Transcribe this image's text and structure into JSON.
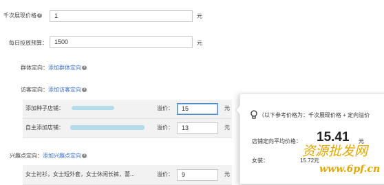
{
  "form": {
    "cpm": {
      "label": "千次展现价格",
      "value": "1",
      "unit": "元"
    },
    "daily_budget": {
      "label": "每日投放预算：",
      "value": "1500",
      "unit": "元"
    },
    "group_targeting": {
      "label": "群体定向：",
      "link": "添加群体定向"
    },
    "visitor_targeting": {
      "label": "访客定向：",
      "link": "添加访客定向"
    },
    "seed_shops": {
      "label": "添加种子店铺：",
      "premium_label": "溢价：",
      "value": "15",
      "unit": "元"
    },
    "own_shop": {
      "label": "自主添加店铺：",
      "premium_label": "溢价：",
      "value": "13",
      "unit": "元"
    },
    "interest_targeting": {
      "label": "兴趣点定向：",
      "link": "添加兴趣点定向"
    },
    "interest_row": {
      "label": "女士衬衫，女士短外套，女士休闲长裤，蕾...",
      "premium_label": "溢价：",
      "value": "9",
      "unit": "元"
    }
  },
  "popover": {
    "hint": "（以下参考价格为：千次展现价格 + 定向溢价",
    "avg_label": "店铺定向平均价格：",
    "avg_value": "15.41",
    "avg_unit": "元",
    "sub_label": "女装：",
    "sub_value": "15.72元"
  },
  "watermark": {
    "cn": "资源批发网",
    "url": "www.6pf.cn"
  },
  "colors": {
    "link": "#3a70c4",
    "focus": "#4a8fd6",
    "watermark": "#e3a800"
  }
}
